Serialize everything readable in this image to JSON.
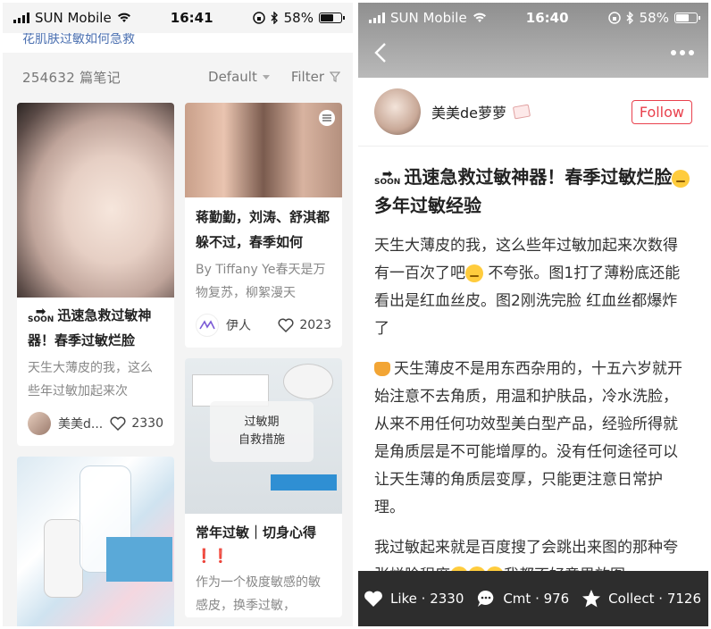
{
  "status": {
    "carrier": "SUN Mobile",
    "left_time": "16:41",
    "right_time": "16:40",
    "battery": "58%"
  },
  "left": {
    "search_partial": "花肌肤过敏如何急救",
    "count": "254632 篇笔记",
    "sort": "Default",
    "filter": "Filter",
    "cards": [
      {
        "title": "迅速急救过敏神器！春季过敏烂脸",
        "desc": "天生大薄皮的我，这么些年过敏加起来次",
        "author": "美美d...",
        "likes": "2330"
      },
      {
        "title": "蒋勤勤，刘涛、舒淇都躲不过，春季如何",
        "desc": "By Tiffany Ye春天是万物复苏，柳絮漫天",
        "author": "伊人",
        "likes": "2023"
      },
      {
        "overlay": "过敏期\n自救措施",
        "title": "常年过敏｜切身心得 ❗❗",
        "desc": "作为一个极度敏感的敏感皮，换季过敏，"
      }
    ]
  },
  "right": {
    "author": "美美de萝萝",
    "follow": "Follow",
    "title_a": "迅速急救过敏神器！春季过敏烂脸",
    "title_b": "多年过敏经验",
    "p1a": "天生大薄皮的我，这么些年过敏加起来次数得有一百次了吧",
    "p1b": "不夸张。图1打了薄粉底还能看出是红血丝皮。图2刚洗完脸 红血丝都爆炸了",
    "p2": "天生薄皮不是用东西杂用的，十五六岁就开始注意不去角质，用温和护肤品，冷水洗脸，从来不用任何功效型美白型产品，经验所得就是角质层是不可能增厚的。没有任何途径可以让天生薄的角质层变厚，只能更注意日常护理。",
    "p3": "我过敏起来就是百度搜了会跳出来图的那种夸张烂脸程度",
    "p3b": "我都不好意思放图",
    "like": "Like · 2330",
    "cmt": "Cmt · 976",
    "collect": "Collect · 7126"
  }
}
